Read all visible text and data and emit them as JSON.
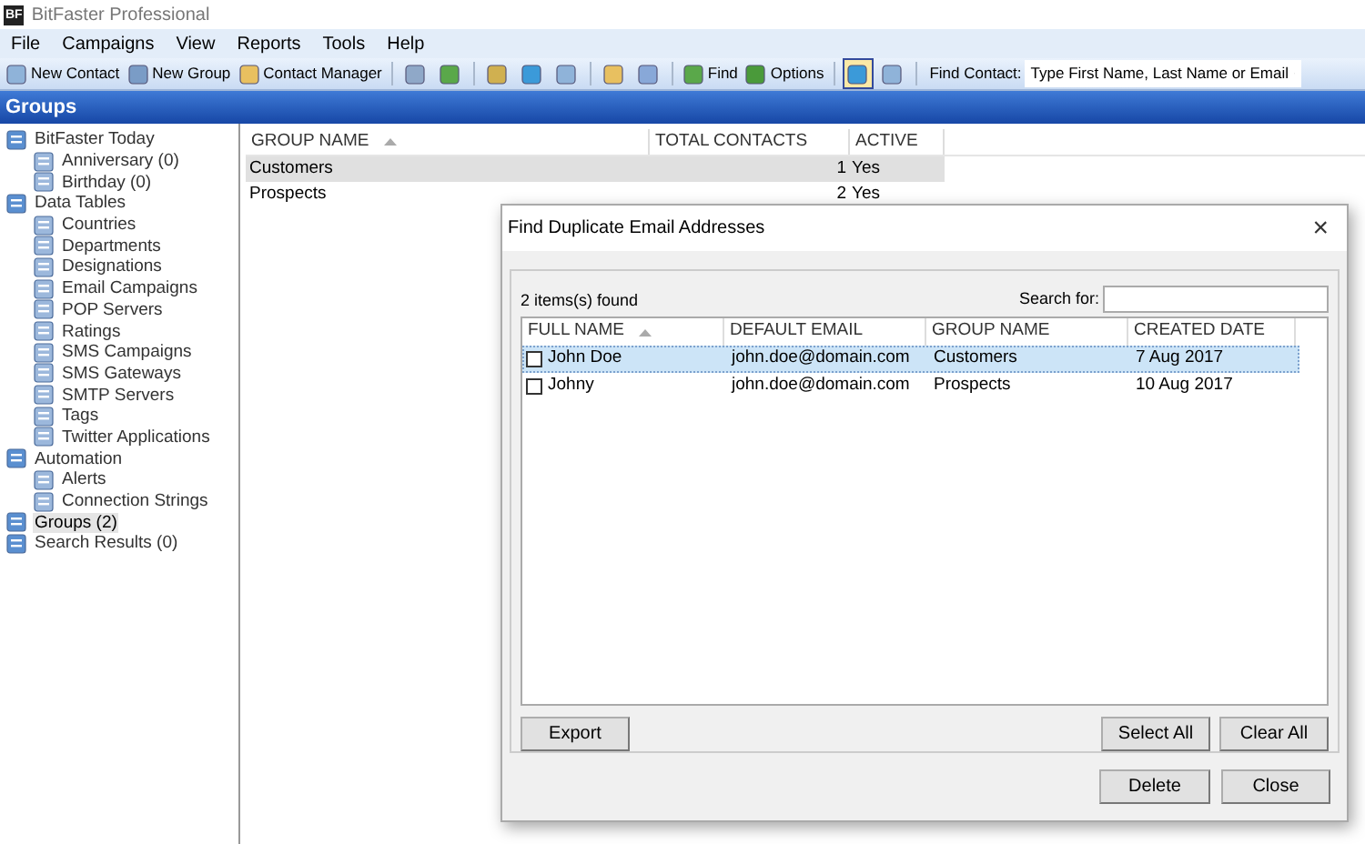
{
  "window": {
    "title": "BitFaster Professional",
    "logo": "BF"
  },
  "menu": [
    "File",
    "Campaigns",
    "View",
    "Reports",
    "Tools",
    "Help"
  ],
  "toolbar": [
    {
      "kind": "button",
      "label": "New Contact",
      "pressed": false
    },
    {
      "kind": "button",
      "label": "New Group",
      "pressed": false
    },
    {
      "kind": "button",
      "label": "Contact Manager",
      "pressed": false
    },
    {
      "kind": "separator"
    },
    {
      "kind": "icon",
      "pressed": false
    },
    {
      "kind": "icon",
      "pressed": false
    },
    {
      "kind": "separator"
    },
    {
      "kind": "icon",
      "pressed": false
    },
    {
      "kind": "icon",
      "pressed": false
    },
    {
      "kind": "icon",
      "pressed": false
    },
    {
      "kind": "separator"
    },
    {
      "kind": "icon",
      "pressed": false
    },
    {
      "kind": "icon",
      "pressed": false
    },
    {
      "kind": "separator"
    },
    {
      "kind": "button",
      "label": "Find",
      "pressed": false
    },
    {
      "kind": "button",
      "label": "Options",
      "pressed": false
    },
    {
      "kind": "separator"
    },
    {
      "kind": "icon",
      "pressed": true
    },
    {
      "kind": "icon",
      "pressed": false
    },
    {
      "kind": "separator"
    }
  ],
  "find_contact": {
    "label": "Find Contact:",
    "value": "Type First Name, Last Name or Email"
  },
  "panel_title": "Groups",
  "tree": [
    {
      "label": "BitFaster Today",
      "selected": false,
      "children": [
        {
          "label": "Anniversary (0)",
          "selected": false
        },
        {
          "label": "Birthday (0)",
          "selected": false
        }
      ]
    },
    {
      "label": "Data Tables",
      "selected": false,
      "children": [
        {
          "label": "Countries",
          "selected": false
        },
        {
          "label": "Departments",
          "selected": false
        },
        {
          "label": "Designations",
          "selected": false
        },
        {
          "label": "Email Campaigns",
          "selected": false
        },
        {
          "label": "POP Servers",
          "selected": false
        },
        {
          "label": "Ratings",
          "selected": false
        },
        {
          "label": "SMS Campaigns",
          "selected": false
        },
        {
          "label": "SMS Gateways",
          "selected": false
        },
        {
          "label": "SMTP Servers",
          "selected": false
        },
        {
          "label": "Tags",
          "selected": false
        },
        {
          "label": "Twitter Applications",
          "selected": false
        }
      ]
    },
    {
      "label": "Automation",
      "selected": false,
      "children": [
        {
          "label": "Alerts",
          "selected": false
        },
        {
          "label": "Connection Strings",
          "selected": false
        }
      ]
    },
    {
      "label": "Groups (2)",
      "selected": true
    },
    {
      "label": "Search Results (0)",
      "selected": false
    }
  ],
  "table": {
    "columns": [
      "GROUP NAME",
      "TOTAL CONTACTS",
      "ACTIVE"
    ],
    "rows": [
      {
        "cells": [
          "Customers",
          "1",
          "Yes"
        ],
        "selected": true
      },
      {
        "cells": [
          "Prospects",
          "2",
          "Yes"
        ],
        "selected": false
      }
    ]
  },
  "dialog": {
    "title": "Find Duplicate Email Addresses",
    "close": "×",
    "count": "2 items(s) found",
    "search_label": "Search for:",
    "columns": [
      "FULL NAME",
      "DEFAULT EMAIL",
      "GROUP NAME",
      "CREATED DATE"
    ],
    "rows": [
      {
        "cells": [
          "John Doe",
          "john.doe@domain.com",
          "Customers",
          "7 Aug 2017"
        ],
        "checked": false,
        "selected": true
      },
      {
        "cells": [
          "Johny",
          "john.doe@domain.com",
          "Prospects",
          "10 Aug 2017"
        ],
        "checked": false,
        "selected": false
      }
    ],
    "list_buttons": [
      "Export",
      "Select All",
      "Clear All"
    ],
    "buttons": [
      "Delete",
      "Close"
    ]
  }
}
